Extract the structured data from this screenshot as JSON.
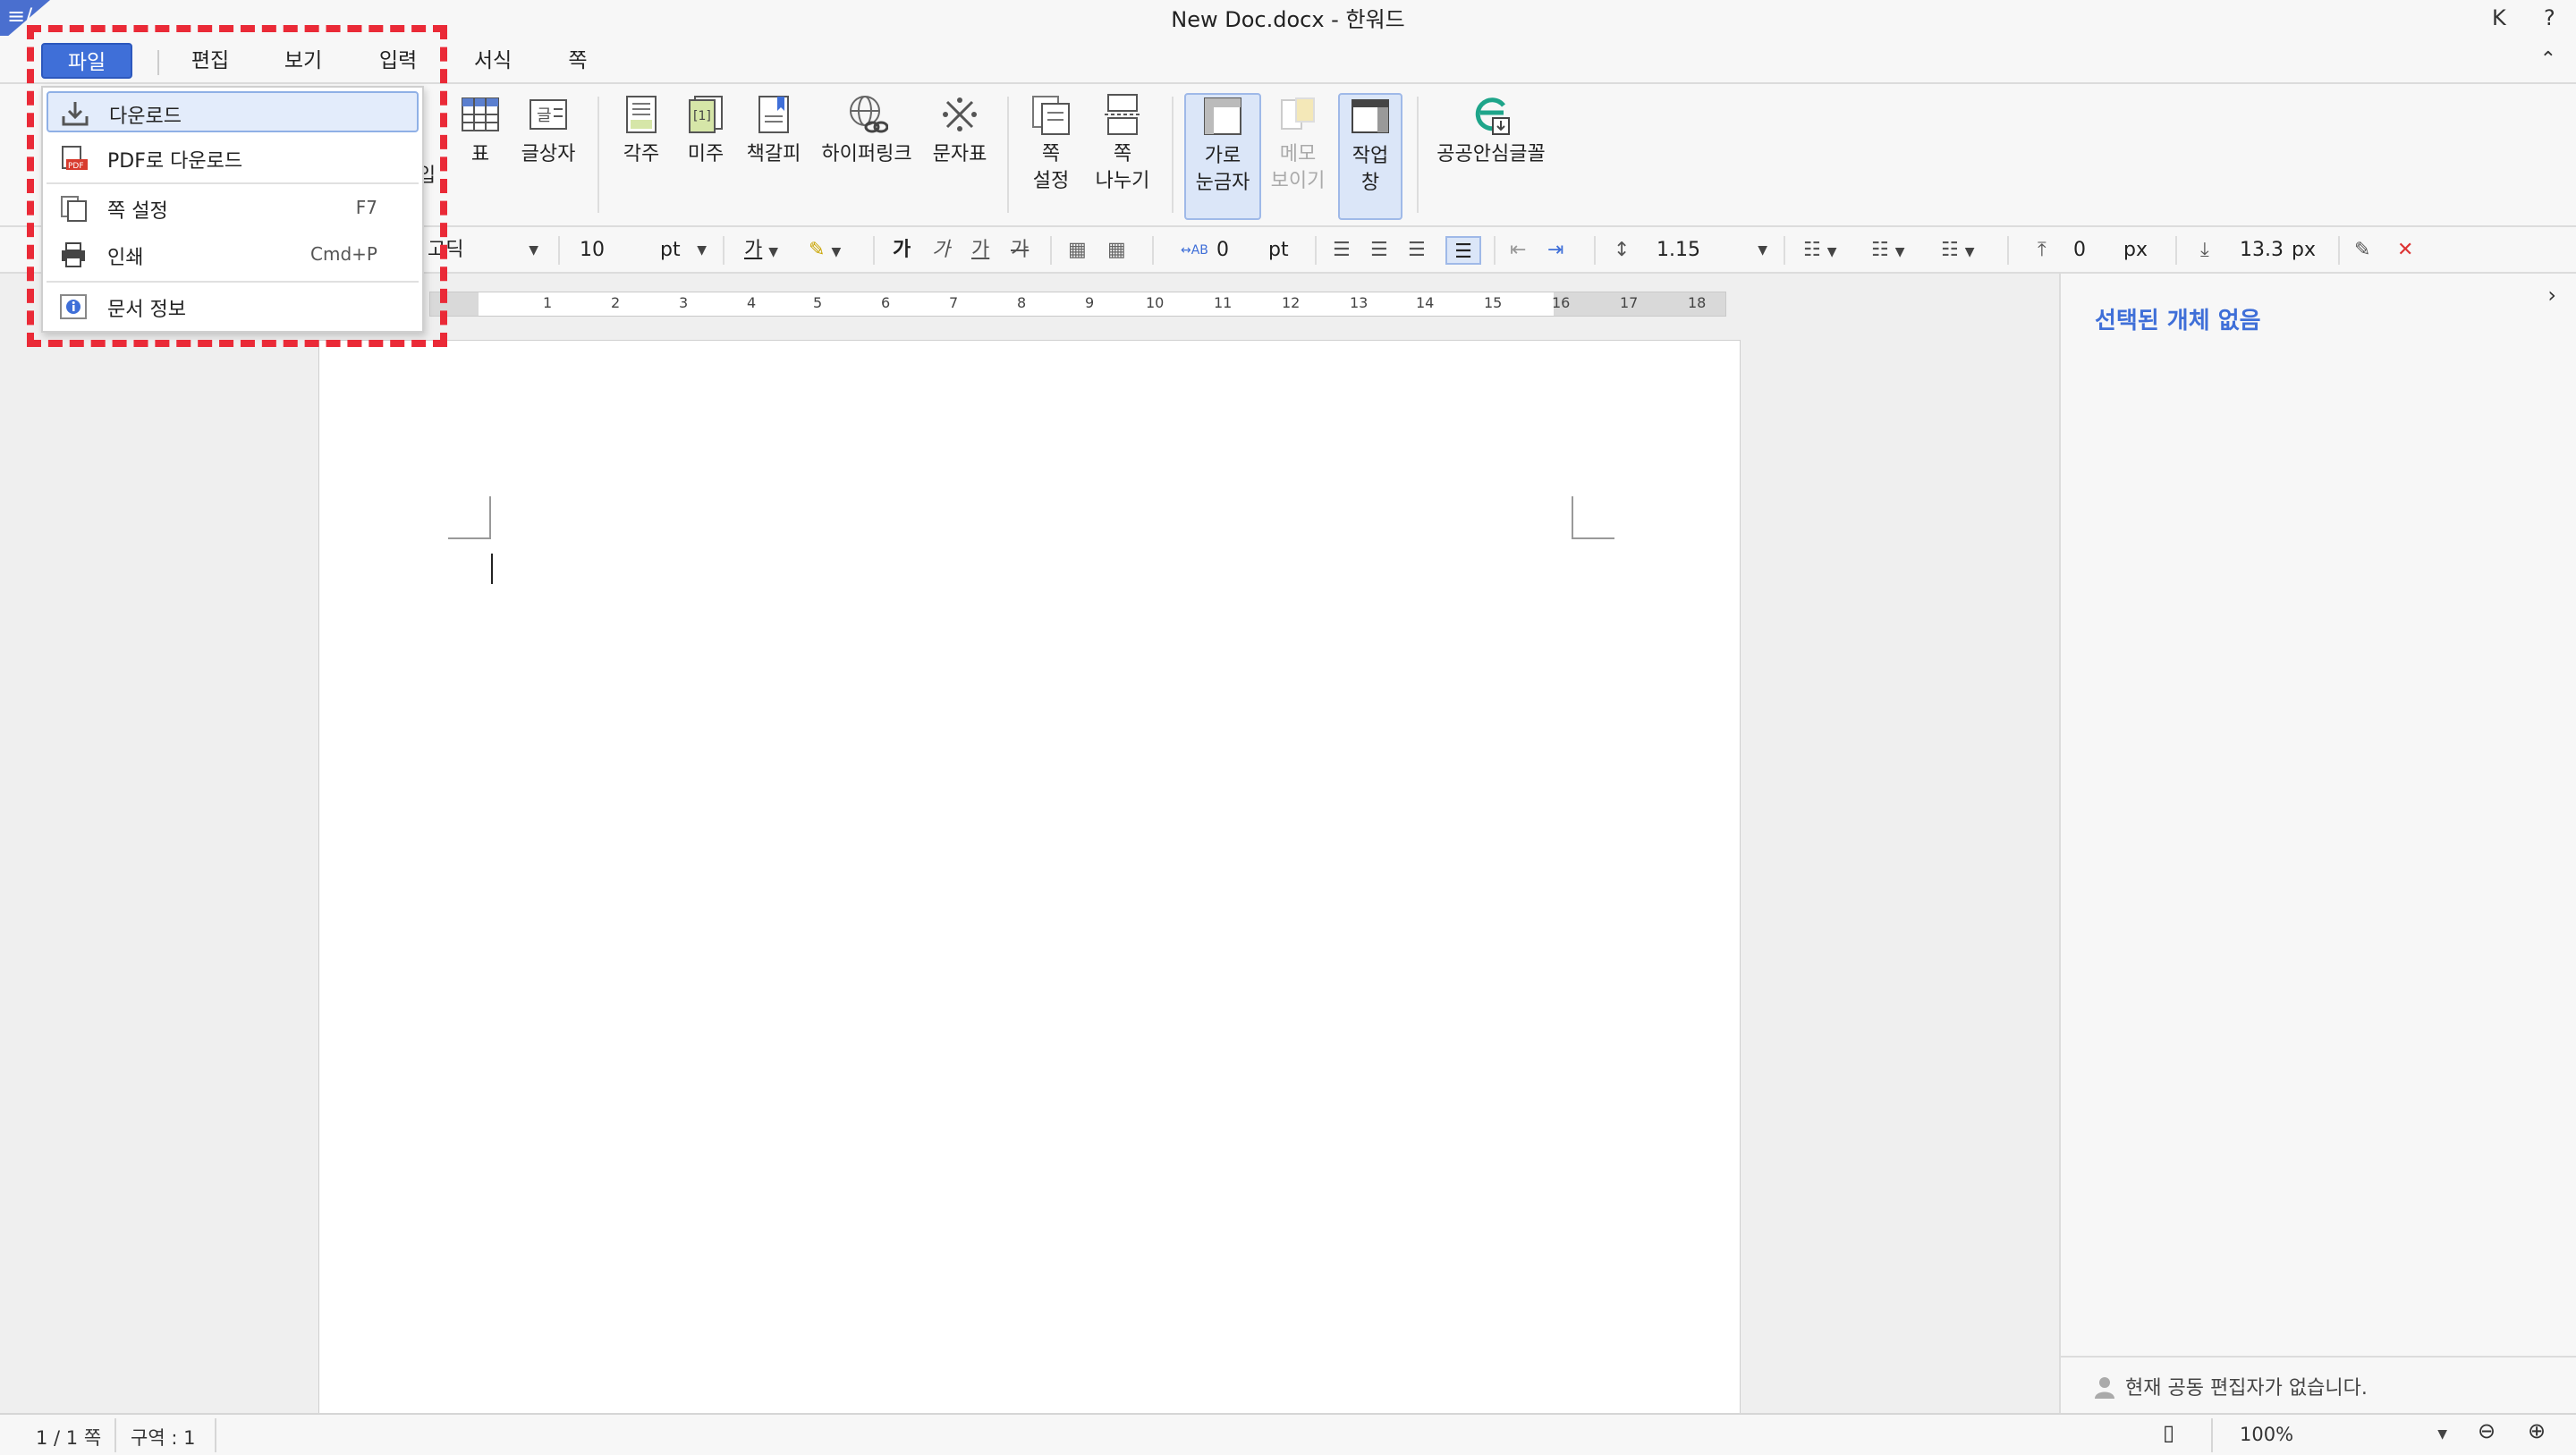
{
  "window": {
    "title": "New Doc.docx - 한워드",
    "user_initial": "K",
    "help": "?",
    "logo_glyph": "≡/"
  },
  "menu": [
    {
      "label": "파일",
      "active": true
    },
    {
      "label": "편집"
    },
    {
      "label": "보기"
    },
    {
      "label": "입력"
    },
    {
      "label": "서식"
    },
    {
      "label": "쪽"
    }
  ],
  "ribbon": {
    "items": [
      {
        "label": "표",
        "icon": "table-icon"
      },
      {
        "label": "글상자",
        "icon": "textbox-icon"
      },
      {
        "label": "각주",
        "icon": "footnote-icon"
      },
      {
        "label": "미주",
        "icon": "endnote-icon"
      },
      {
        "label": "책갈피",
        "icon": "bookmark-icon"
      },
      {
        "label": "하이퍼링크",
        "icon": "hyperlink-icon"
      },
      {
        "label": "문자표",
        "icon": "symbol-icon"
      },
      {
        "label": "쪽\n설정",
        "icon": "page-setup-icon"
      },
      {
        "label": "쪽\n나누기",
        "icon": "page-break-icon"
      },
      {
        "label": "가로\n눈금자",
        "icon": "ruler-icon",
        "active": true
      },
      {
        "label": "메모\n보이기",
        "icon": "memo-icon",
        "disabled": true
      },
      {
        "label": "작업\n창",
        "icon": "task-pane-icon",
        "active": true
      },
      {
        "label": "공공안심글꼴",
        "icon": "public-font-icon"
      }
    ],
    "partial_label": "입"
  },
  "format": {
    "font_name": "고딕",
    "font_size": "10",
    "font_unit": "pt",
    "char_spacing": "0",
    "char_spacing_unit": "pt",
    "line_spacing": "1.15",
    "para_before": "0",
    "para_before_unit": "px",
    "para_after": "13.3",
    "para_after_unit": "px",
    "bold_glyph": "가",
    "font_color_glyph": "가"
  },
  "ruler": {
    "numbers": [
      "1",
      "2",
      "3",
      "4",
      "5",
      "6",
      "7",
      "8",
      "9",
      "10",
      "11",
      "12",
      "13",
      "14",
      "15",
      "16",
      "17",
      "18"
    ]
  },
  "sidebar": {
    "title": "선택된 개체 없음",
    "collab_text": "현재 공동 편집자가 없습니다."
  },
  "status": {
    "page": "1 / 1 쪽",
    "section": "구역 : 1",
    "zoom": "100%"
  },
  "file_menu": {
    "items": [
      {
        "label": "다운로드",
        "icon": "download-icon",
        "shortcut": "",
        "highlighted": true
      },
      {
        "label": "PDF로 다운로드",
        "icon": "pdf-icon",
        "shortcut": ""
      },
      {
        "label": "쪽 설정",
        "icon": "page-setup-icon",
        "shortcut": "F7"
      },
      {
        "label": "인쇄",
        "icon": "print-icon",
        "shortcut": "Cmd+P"
      },
      {
        "label": "문서 정보",
        "icon": "info-icon",
        "shortcut": ""
      }
    ]
  },
  "colors": {
    "accent": "#3f6fd8",
    "highlight_box": "#ea2a37"
  }
}
